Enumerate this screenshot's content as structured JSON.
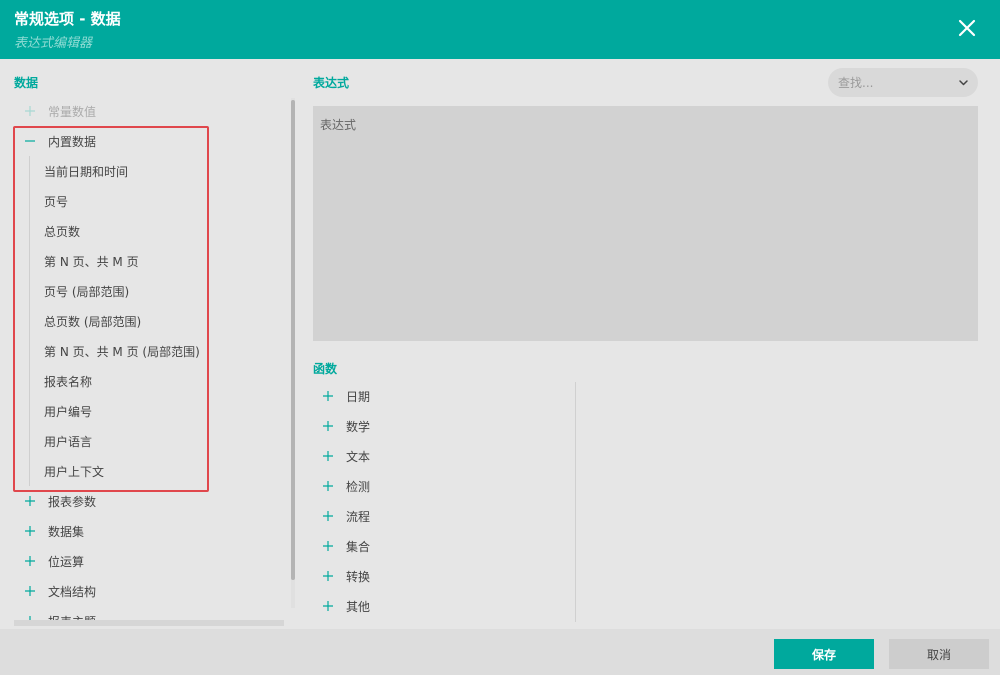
{
  "header": {
    "title": "常规选项 - 数据",
    "subtitle": "表达式编辑器",
    "close_icon": "close-icon"
  },
  "data_panel": {
    "label": "数据",
    "tree": [
      {
        "label": "常量数值",
        "icon": "plus-icon",
        "disabled": true
      },
      {
        "label": "内置数据",
        "icon": "minus-icon",
        "expanded": true,
        "children": [
          "当前日期和时间",
          "页号",
          "总页数",
          "第 N 页、共 M 页",
          "页号 (局部范围)",
          "总页数 (局部范围)",
          "第 N 页、共 M 页 (局部范围)",
          "报表名称",
          "用户编号",
          "用户语言",
          "用户上下文"
        ]
      },
      {
        "label": "报表参数",
        "icon": "plus-icon"
      },
      {
        "label": "数据集",
        "icon": "plus-icon"
      },
      {
        "label": "位运算",
        "icon": "plus-icon"
      },
      {
        "label": "文档结构",
        "icon": "plus-icon"
      },
      {
        "label": "报表主题",
        "icon": "plus-icon"
      }
    ]
  },
  "expression": {
    "label": "表达式",
    "placeholder": "表达式",
    "value": ""
  },
  "search": {
    "placeholder": "查找...",
    "icon": "chevron-down-icon"
  },
  "functions": {
    "label": "函数",
    "items": [
      "日期",
      "数学",
      "文本",
      "检测",
      "流程",
      "集合",
      "转换",
      "其他"
    ]
  },
  "footer": {
    "save_label": "保存",
    "cancel_label": "取消"
  },
  "colors": {
    "accent": "#00a99d",
    "highlight": "#e0474c",
    "background": "#e6e6e6"
  }
}
